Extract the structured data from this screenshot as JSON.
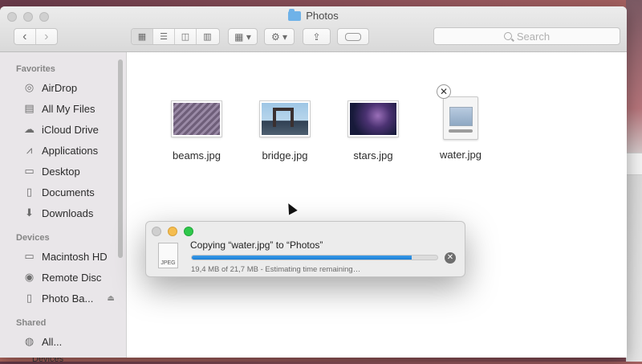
{
  "window": {
    "title": "Photos",
    "search_placeholder": "Search"
  },
  "toolbar": {
    "back_glyph": "‹",
    "forward_glyph": "›",
    "view_modes": [
      "icon",
      "list",
      "column",
      "cover-flow"
    ],
    "active_view": "icon"
  },
  "sidebar": {
    "favorites_heading": "Favorites",
    "favorites": [
      {
        "label": "AirDrop",
        "icon": "airdrop-icon"
      },
      {
        "label": "All My Files",
        "icon": "all-files-icon"
      },
      {
        "label": "iCloud Drive",
        "icon": "cloud-icon"
      },
      {
        "label": "Applications",
        "icon": "applications-icon"
      },
      {
        "label": "Desktop",
        "icon": "desktop-icon"
      },
      {
        "label": "Documents",
        "icon": "documents-icon"
      },
      {
        "label": "Downloads",
        "icon": "downloads-icon"
      }
    ],
    "devices_heading": "Devices",
    "devices": [
      {
        "label": "Macintosh HD",
        "icon": "hard-drive-icon"
      },
      {
        "label": "Remote Disc",
        "icon": "disc-icon"
      },
      {
        "label": "Photo Ba...",
        "icon": "drive-icon"
      }
    ],
    "shared_heading": "Shared",
    "shared": [
      {
        "label": "All...",
        "icon": "network-icon"
      }
    ]
  },
  "files": [
    {
      "name": "beams.jpg"
    },
    {
      "name": "bridge.jpg"
    },
    {
      "name": "stars.jpg"
    },
    {
      "name": "water.jpg"
    }
  ],
  "copy_dialog": {
    "title": "Copying “water.jpg” to “Photos”",
    "status": "19,4 MB of 21,7 MB - Estimating time remaining…",
    "progress": 0.894,
    "file_type_label": "JPEG"
  },
  "desktop": {
    "partial_text": "Devices"
  },
  "colors": {
    "progress_fill": "#1a7fd6",
    "folder_blue": "#6fb2e8"
  }
}
